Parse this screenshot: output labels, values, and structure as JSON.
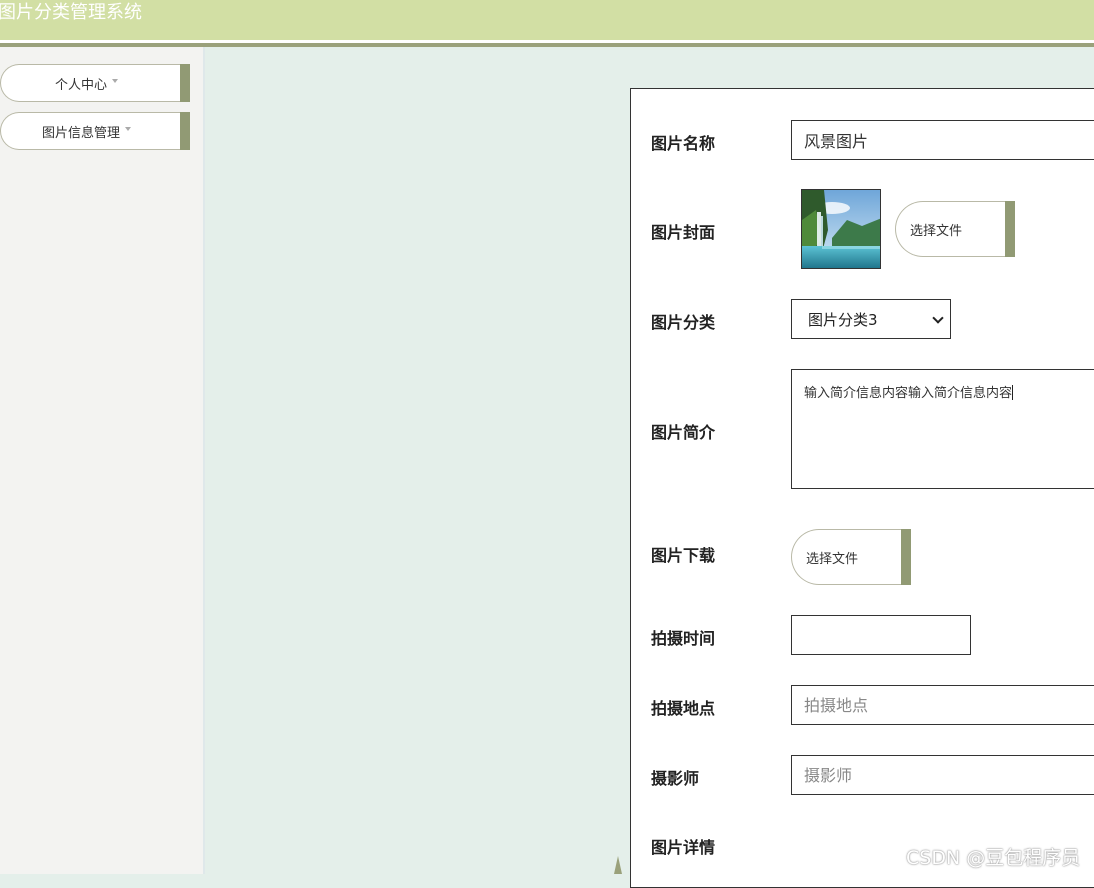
{
  "header": {
    "title": "图片分类管理系统"
  },
  "sidebar": {
    "items": [
      {
        "label": "个人中心"
      },
      {
        "label": "图片信息管理"
      }
    ]
  },
  "form": {
    "fields": {
      "name": {
        "label": "图片名称",
        "value": "风景图片"
      },
      "cover": {
        "label": "图片封面",
        "button": "选择文件"
      },
      "category": {
        "label": "图片分类",
        "selected": "图片分类3"
      },
      "intro": {
        "label": "图片简介",
        "value": "输入简介信息内容输入简介信息内容"
      },
      "download": {
        "label": "图片下载",
        "button": "选择文件"
      },
      "shoot_time": {
        "label": "拍摄时间",
        "value": ""
      },
      "location": {
        "label": "拍摄地点",
        "placeholder": "拍摄地点"
      },
      "photographer": {
        "label": "摄影师",
        "placeholder": "摄影师"
      },
      "details": {
        "label": "图片详情"
      }
    }
  },
  "watermark": "CSDN @豆包程序员",
  "colors": {
    "header_bg": "#d2dfa4",
    "accent_bar": "#919a74",
    "content_bg": "#e4efea",
    "sidebar_bg": "#f3f3f1"
  }
}
